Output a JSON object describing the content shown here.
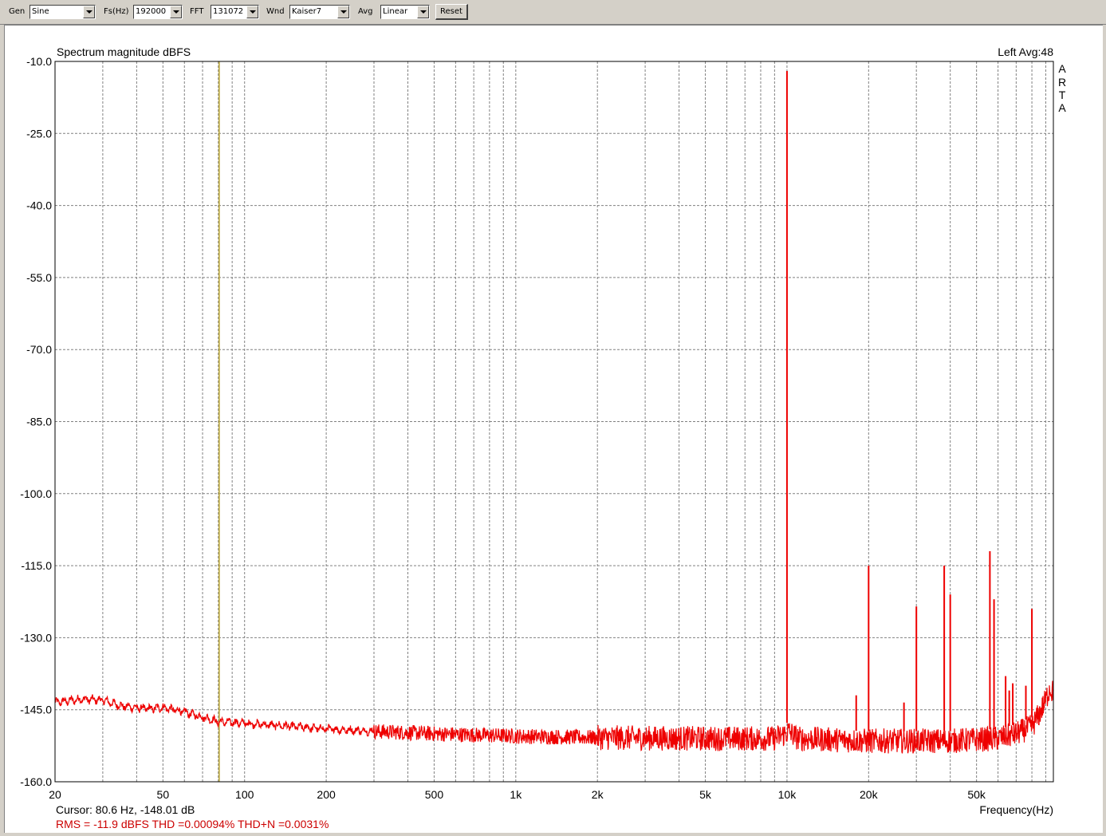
{
  "toolbar": {
    "gen_label": "Gen",
    "gen_value": "Sine",
    "fs_label": "Fs(Hz)",
    "fs_value": "192000",
    "fft_label": "FFT",
    "fft_value": "131072",
    "wnd_label": "Wnd",
    "wnd_value": "Kaiser7",
    "avg_label": "Avg",
    "avg_value": "Linear",
    "reset_label": "Reset"
  },
  "graph": {
    "left_avg": "Left  Avg:48",
    "arta_letters": [
      "A",
      "R",
      "T",
      "A"
    ],
    "cursor_text": "Cursor:    80.6 Hz, -148.01 dB",
    "stats_text": "RMS =  -11.9 dBFS   THD =0.00094%   THD+N =0.0031%"
  },
  "colors": {
    "trace": "#ee0000",
    "cursor_line": "#b7a230",
    "grid": "#808080",
    "stats_text": "#cc0000"
  },
  "chart_data": {
    "type": "line",
    "title": "Spectrum magnitude dBFS",
    "xlabel": "Frequency(Hz)",
    "ylabel": "",
    "x_scale": "log",
    "xlim": [
      20,
      96000
    ],
    "ylim": [
      -160,
      -10
    ],
    "x_ticks": [
      {
        "value": 20,
        "label": "20"
      },
      {
        "value": 50,
        "label": "50"
      },
      {
        "value": 100,
        "label": "100"
      },
      {
        "value": 200,
        "label": "200"
      },
      {
        "value": 500,
        "label": "500"
      },
      {
        "value": 1000,
        "label": "1k"
      },
      {
        "value": 2000,
        "label": "2k"
      },
      {
        "value": 5000,
        "label": "5k"
      },
      {
        "value": 10000,
        "label": "10k"
      },
      {
        "value": 20000,
        "label": "20k"
      },
      {
        "value": 50000,
        "label": "50k"
      }
    ],
    "y_ticks": [
      {
        "value": -10,
        "label": "-10.0"
      },
      {
        "value": -25,
        "label": "-25.0"
      },
      {
        "value": -40,
        "label": "-40.0"
      },
      {
        "value": -55,
        "label": "-55.0"
      },
      {
        "value": -70,
        "label": "-70.0"
      },
      {
        "value": -85,
        "label": "-85.0"
      },
      {
        "value": -100,
        "label": "-100.0"
      },
      {
        "value": -115,
        "label": "-115.0"
      },
      {
        "value": -130,
        "label": "-130.0"
      },
      {
        "value": -145,
        "label": "-145.0"
      },
      {
        "value": -160,
        "label": "-160.0"
      }
    ],
    "grid": true,
    "cursor_frequency_hz": 80.6,
    "series": [
      {
        "noise_floor": [
          [
            20,
            -143.5
          ],
          [
            25,
            -142.8
          ],
          [
            30,
            -143.0
          ],
          [
            35,
            -144.2
          ],
          [
            40,
            -144.6
          ],
          [
            45,
            -144.8
          ],
          [
            50,
            -144.5
          ],
          [
            60,
            -145.5
          ],
          [
            70,
            -146.5
          ],
          [
            80,
            -147.5
          ],
          [
            100,
            -147.8
          ],
          [
            150,
            -148.5
          ],
          [
            200,
            -149.0
          ],
          [
            300,
            -149.5
          ],
          [
            500,
            -150.0
          ],
          [
            1000,
            -150.5
          ],
          [
            2000,
            -150.8
          ],
          [
            5000,
            -151.0
          ],
          [
            9000,
            -151.0
          ],
          [
            9900,
            -150.0
          ],
          [
            10100,
            -149.5
          ],
          [
            11000,
            -151.0
          ],
          [
            20000,
            -151.5
          ],
          [
            40000,
            -151.5
          ],
          [
            60000,
            -151.0
          ],
          [
            70000,
            -150.0
          ],
          [
            80000,
            -148.5
          ],
          [
            85000,
            -146.0
          ],
          [
            90000,
            -143.0
          ],
          [
            93000,
            -140.5
          ],
          [
            96000,
            -141.5
          ]
        ],
        "peaks": [
          {
            "frequency": 10000,
            "db": -12.0
          },
          {
            "frequency": 18000,
            "db": -142.0
          },
          {
            "frequency": 20000,
            "db": -115.0
          },
          {
            "frequency": 27000,
            "db": -143.5
          },
          {
            "frequency": 30000,
            "db": -123.5
          },
          {
            "frequency": 38000,
            "db": -115.0
          },
          {
            "frequency": 40000,
            "db": -121.0
          },
          {
            "frequency": 56000,
            "db": -112.0
          },
          {
            "frequency": 58000,
            "db": -122.0
          },
          {
            "frequency": 64000,
            "db": -138.0
          },
          {
            "frequency": 66000,
            "db": -141.0
          },
          {
            "frequency": 68000,
            "db": -139.5
          },
          {
            "frequency": 76000,
            "db": -140.0
          },
          {
            "frequency": 80000,
            "db": -124.0
          }
        ]
      }
    ]
  }
}
